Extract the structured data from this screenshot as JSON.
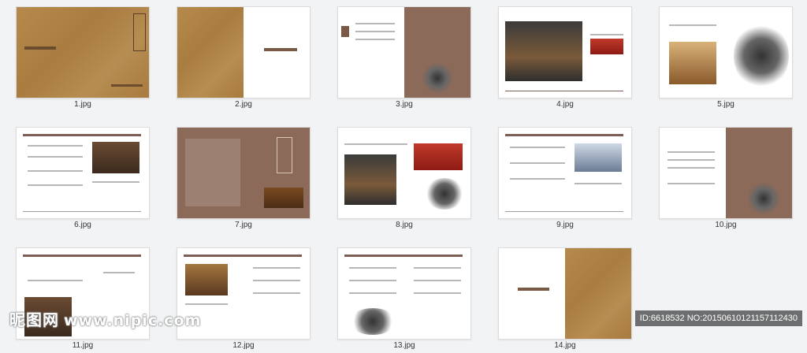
{
  "thumbnails": [
    {
      "label": "1.jpg"
    },
    {
      "label": "2.jpg"
    },
    {
      "label": "3.jpg"
    },
    {
      "label": "4.jpg"
    },
    {
      "label": "5.jpg"
    },
    {
      "label": "6.jpg"
    },
    {
      "label": "7.jpg"
    },
    {
      "label": "8.jpg"
    },
    {
      "label": "9.jpg"
    },
    {
      "label": "10.jpg"
    },
    {
      "label": "11.jpg"
    },
    {
      "label": "12.jpg"
    },
    {
      "label": "13.jpg"
    },
    {
      "label": "14.jpg"
    }
  ],
  "watermark": {
    "brand": "昵图网",
    "url": "www.nipic.com"
  },
  "footer": {
    "id_text": "ID:6618532 NO:20150610121157112430"
  }
}
